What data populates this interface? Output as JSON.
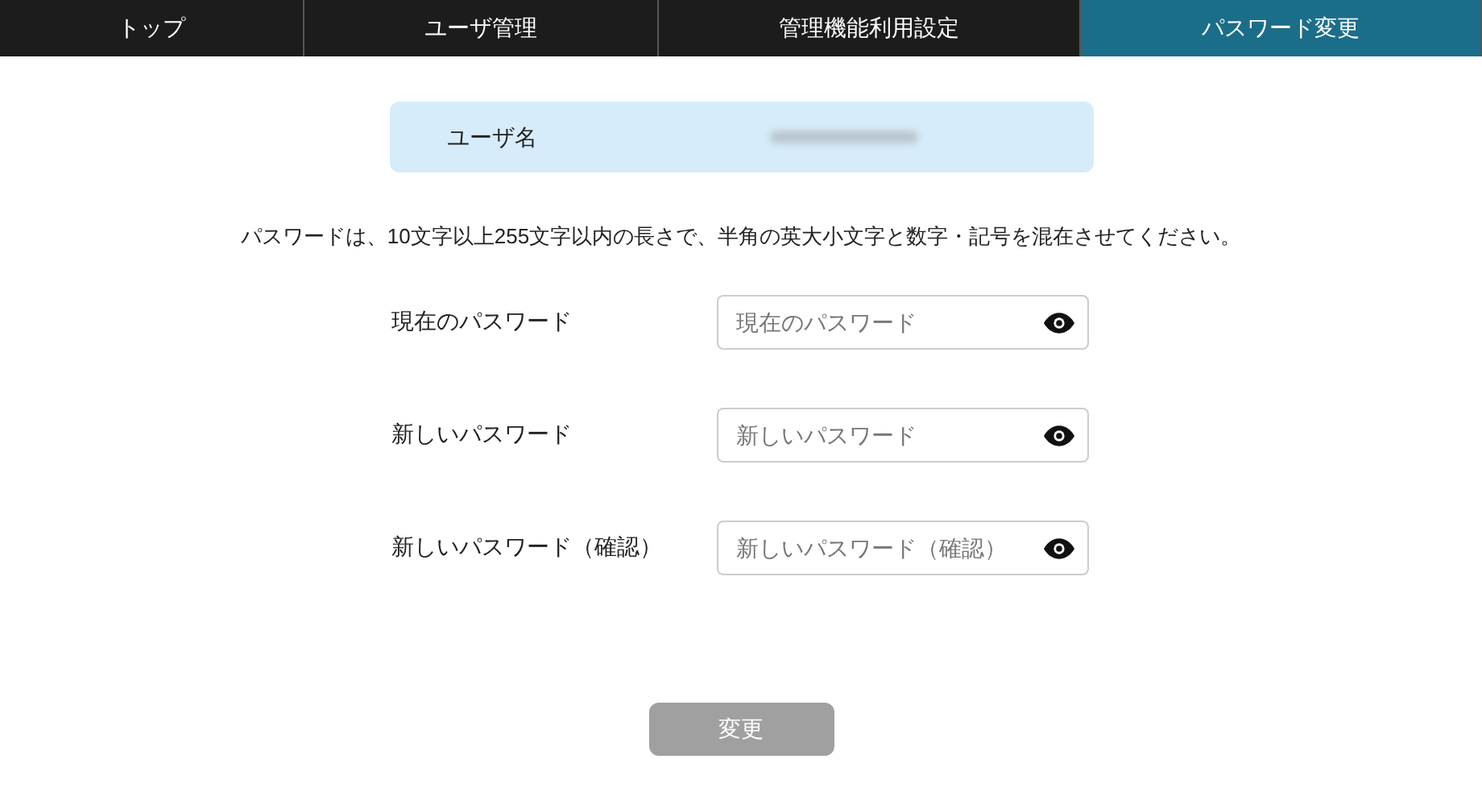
{
  "tabs": [
    {
      "label": "トップ",
      "selected": false
    },
    {
      "label": "ユーザ管理",
      "selected": false
    },
    {
      "label": "管理機能利用設定",
      "selected": false
    },
    {
      "label": "パスワード変更",
      "selected": true
    }
  ],
  "user": {
    "label": "ユーザ名"
  },
  "instruction": "パスワードは、10文字以上255文字以内の長さで、半角の英大小文字と数字・記号を混在させてください。",
  "fields": [
    {
      "label": "現在のパスワード",
      "placeholder": "現在のパスワード"
    },
    {
      "label": "新しいパスワード",
      "placeholder": "新しいパスワード"
    },
    {
      "label": "新しいパスワード（確認）",
      "placeholder": "新しいパスワード（確認）"
    }
  ],
  "submit": {
    "label": "変更",
    "disabled": true
  }
}
